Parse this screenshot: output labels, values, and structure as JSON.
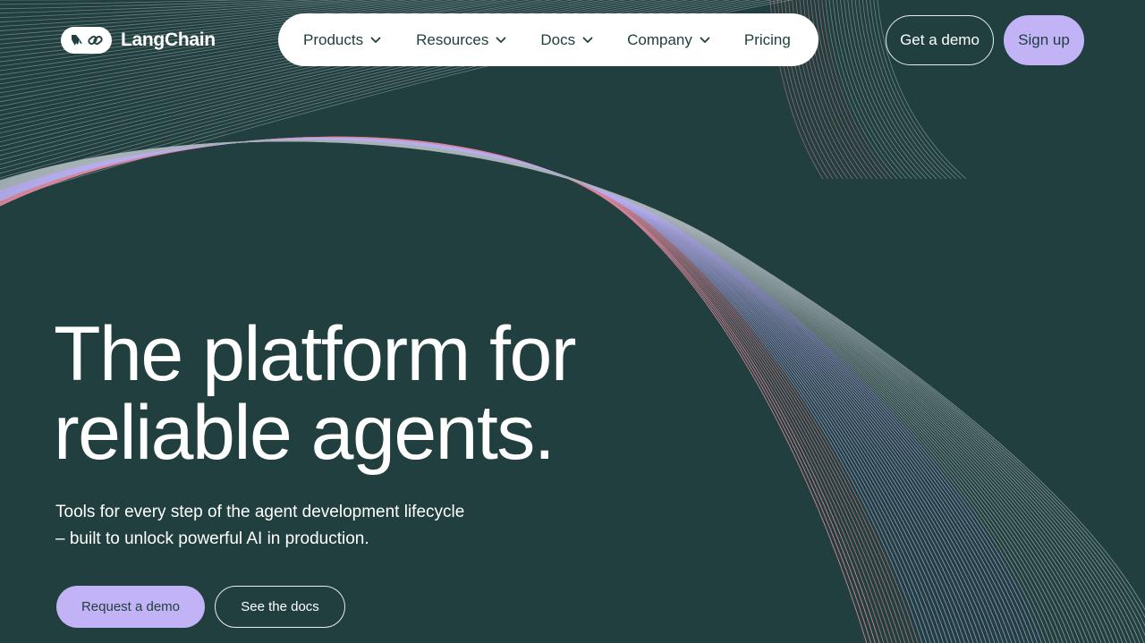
{
  "brand": {
    "name": "LangChain",
    "icon": "parrot-link-logo-icon"
  },
  "nav": {
    "items": [
      {
        "label": "Products",
        "has_dropdown": true
      },
      {
        "label": "Resources",
        "has_dropdown": true
      },
      {
        "label": "Docs",
        "has_dropdown": true
      },
      {
        "label": "Company",
        "has_dropdown": true
      },
      {
        "label": "Pricing",
        "has_dropdown": false
      }
    ]
  },
  "header_actions": {
    "get_demo": "Get a demo",
    "sign_up": "Sign up"
  },
  "hero": {
    "title_line1": "The platform for",
    "title_line2": "reliable agents.",
    "subtitle_line1": "Tools for every step of the agent development lifecycle",
    "subtitle_line2": "– built to unlock powerful AI in production.",
    "primary_cta": "Request a demo",
    "secondary_cta": "See the docs"
  },
  "colors": {
    "background": "#213f3e",
    "accent_lavender": "#c2b3f7",
    "line_pink": "#d9879c",
    "line_lavender": "#b8aef0",
    "line_gray": "#a8b3b6",
    "text_dark": "#213f3e",
    "text_light": "#ffffff"
  }
}
